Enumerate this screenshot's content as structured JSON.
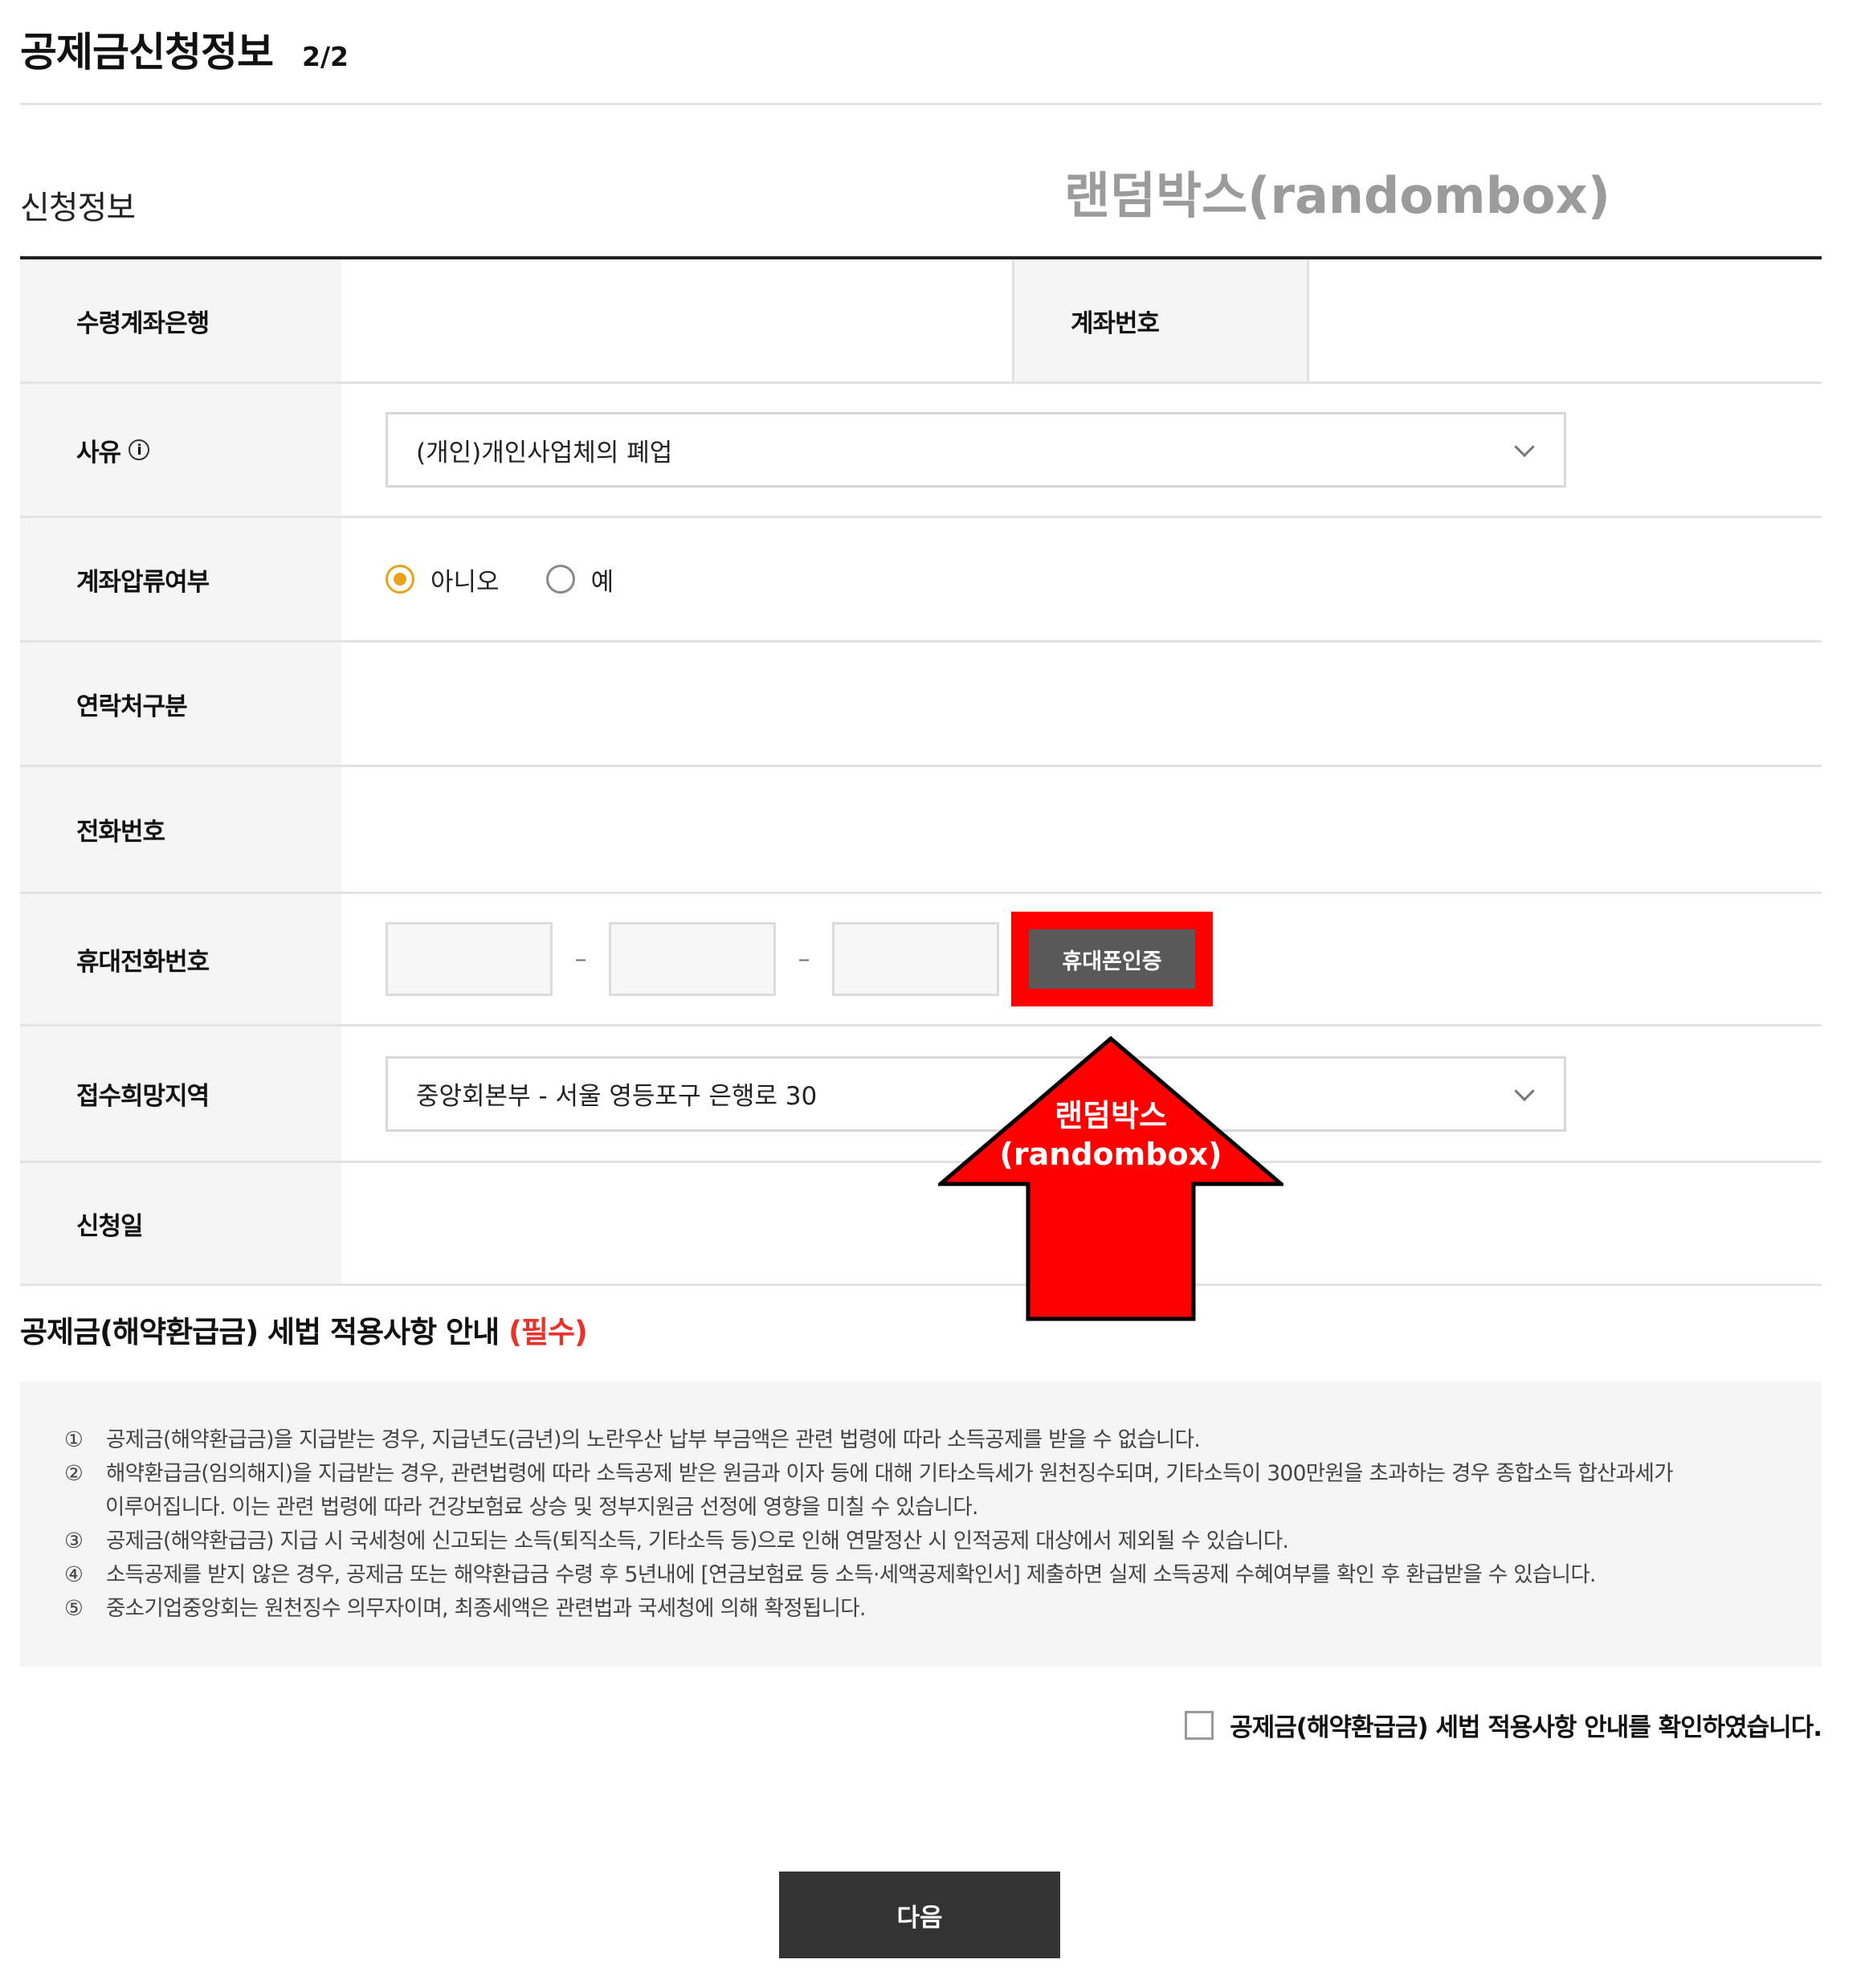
{
  "header": {
    "title": "공제금신청정보",
    "step": "2/2"
  },
  "section": {
    "label": "신청정보"
  },
  "watermark": {
    "top_text": "랜덤박스(randombox)",
    "arrow_line1": "랜덤박스",
    "arrow_line2": "(randombox)",
    "arrow_color": "#ff0000"
  },
  "form": {
    "bank_label": "수령계좌은행",
    "bank_value": "",
    "account_label": "계좌번호",
    "account_value": "",
    "reason_label": "사유",
    "reason_info_icon": "info-circle-icon",
    "reason_value": "(개인)개인사업체의 폐업",
    "seizure_label": "계좌압류여부",
    "seizure_options": [
      "아니오",
      "예"
    ],
    "seizure_selected": "아니오",
    "contact_type_label": "연락처구분",
    "phone_label": "전화번호",
    "mobile_label": "휴대전화번호",
    "mobile_parts": [
      "",
      "",
      ""
    ],
    "verify_button": "휴대폰인증",
    "region_label": "접수희망지역",
    "region_value": "중앙회본부 - 서울 영등포구 은행로 30",
    "apply_date_label": "신청일",
    "apply_date_value": ""
  },
  "notice": {
    "title": "공제금(해약환급금) 세법 적용사항 안내",
    "required": "(필수)",
    "items": [
      {
        "num": "①",
        "text": "공제금(해약환급금)을 지급받는 경우, 지급년도(금년)의 노란우산 납부 부금액은 관련 법령에 따라 소득공제를 받을 수 없습니다."
      },
      {
        "num": "②",
        "text": "해약환급금(임의해지)을 지급받는 경우, 관련법령에 따라 소득공제 받은 원금과 이자 등에 대해 기타소득세가 원천징수되며, 기타소득이 300만원을 초과하는 경우 종합소득 합산과세가",
        "cont": "이루어집니다. 이는 관련 법령에 따라 건강보험료 상승 및 정부지원금 선정에 영향을 미칠 수 있습니다."
      },
      {
        "num": "③",
        "text": "공제금(해약환급금) 지급 시 국세청에 신고되는 소득(퇴직소득, 기타소득 등)으로 인해 연말정산 시 인적공제 대상에서 제외될 수 있습니다."
      },
      {
        "num": "④",
        "text": "소득공제를 받지 않은 경우, 공제금 또는 해약환급금 수령 후 5년내에 [연금보험료 등 소득·세액공제확인서] 제출하면 실제 소득공제 수혜여부를 확인 후 환급받을 수 있습니다."
      },
      {
        "num": "⑤",
        "text": "중소기업중앙회는 원천징수 의무자이며, 최종세액은 관련법과 국세청에 의해 확정됩니다."
      }
    ],
    "confirm_label": "공제금(해약환급금) 세법 적용사항 안내를 확인하였습니다.",
    "confirm_checked": false
  },
  "footer": {
    "next_button": "다음"
  }
}
